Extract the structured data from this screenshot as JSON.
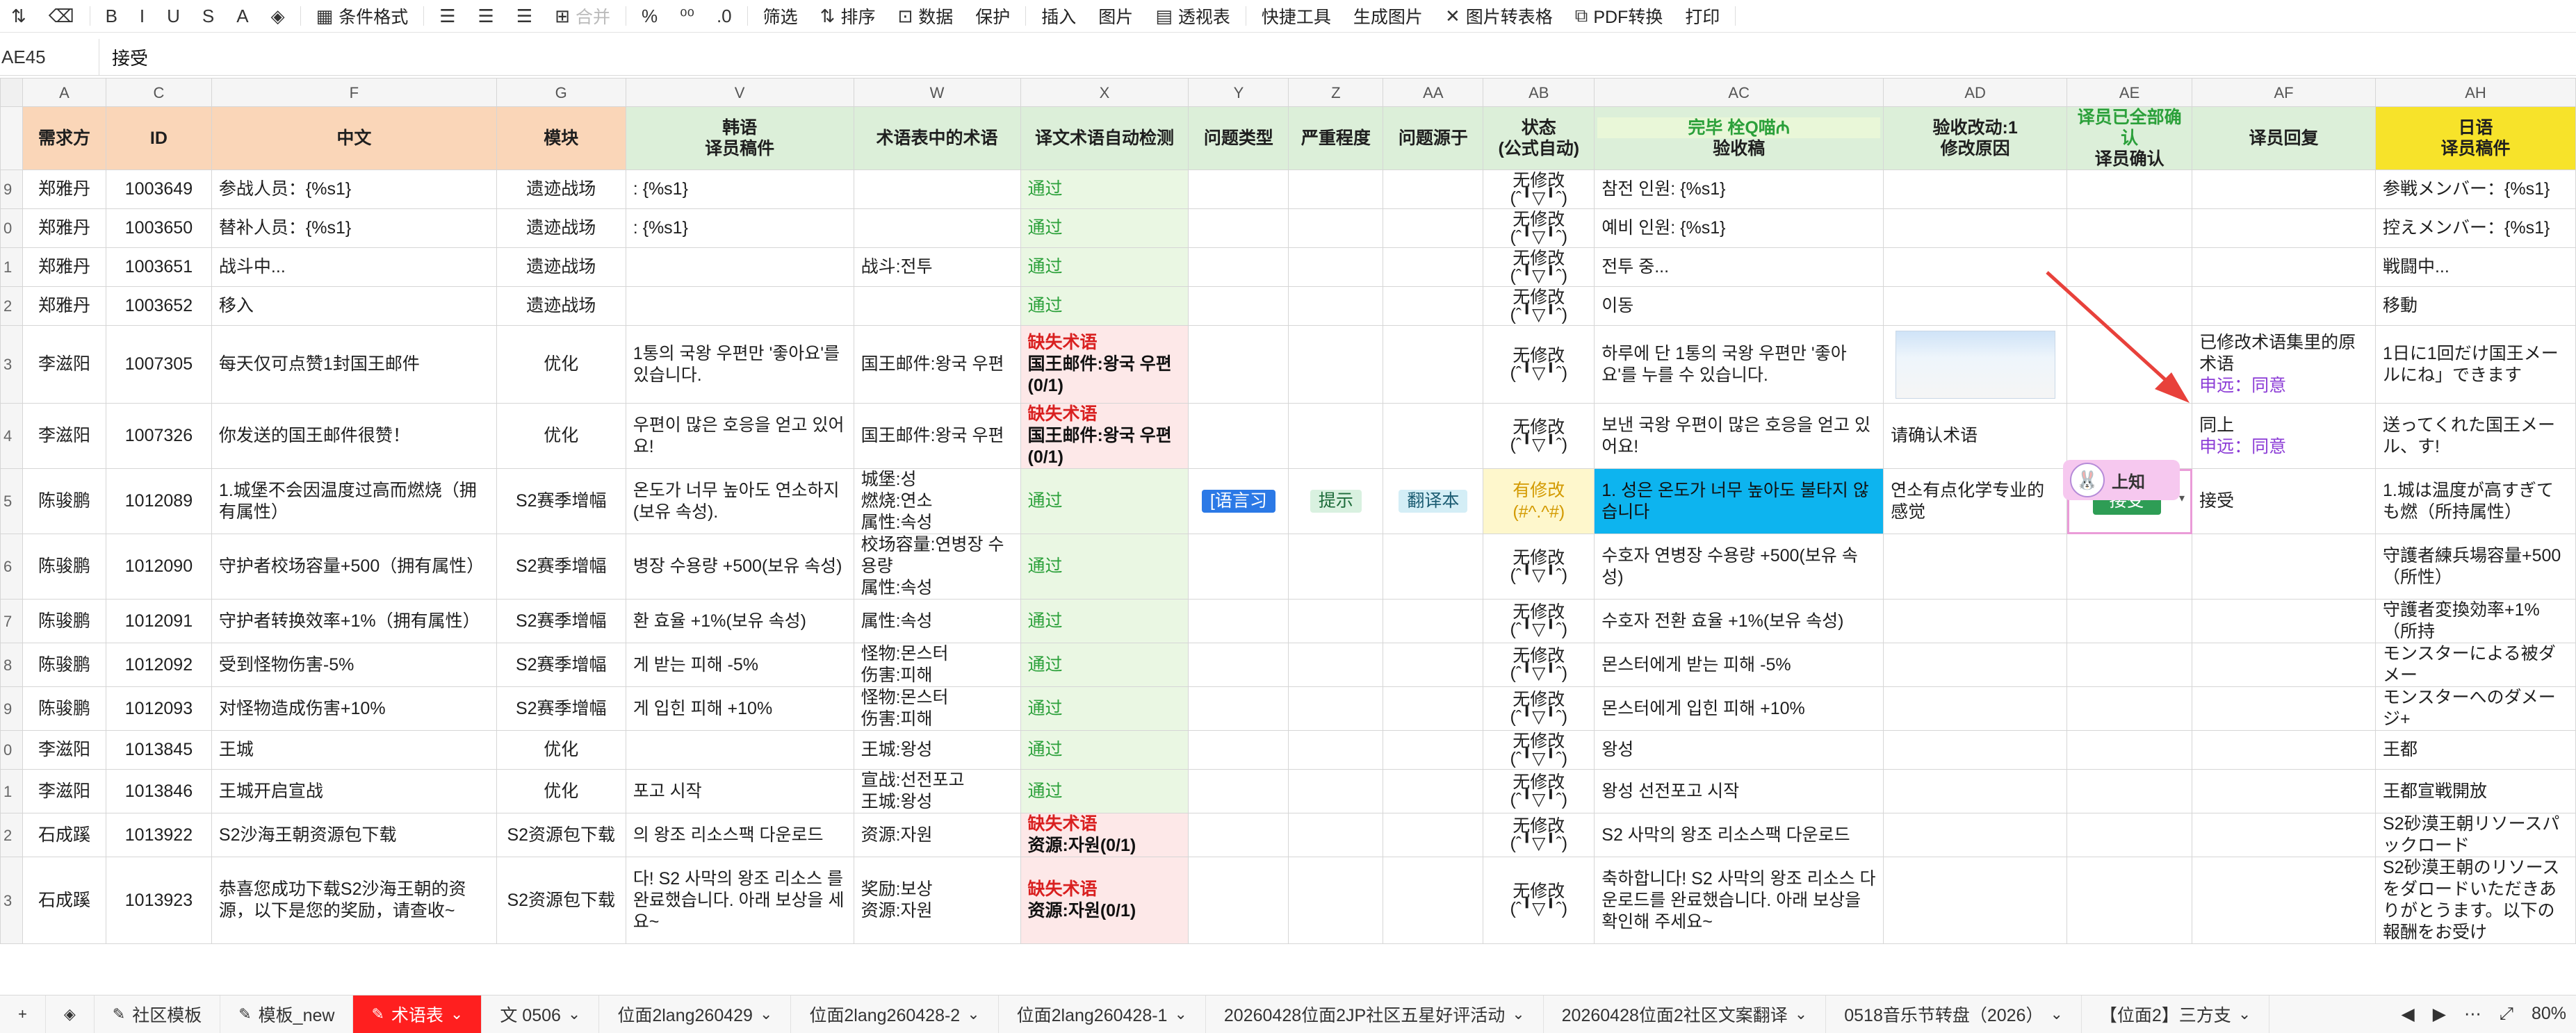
{
  "toolbar": {
    "items": [
      {
        "icon": "format-painter-icon",
        "glyph": "⇅",
        "label": ""
      },
      {
        "icon": "eraser-icon",
        "glyph": "⌫",
        "label": ""
      },
      {
        "icon": "bold-icon",
        "glyph": "B",
        "label": ""
      },
      {
        "icon": "italic-icon",
        "glyph": "I",
        "label": ""
      },
      {
        "icon": "underline-icon",
        "glyph": "U",
        "label": ""
      },
      {
        "icon": "strikethrough-icon",
        "glyph": "S",
        "label": ""
      },
      {
        "icon": "font-color-icon",
        "glyph": "A",
        "label": ""
      },
      {
        "icon": "fill-color-icon",
        "glyph": "◈",
        "label": ""
      },
      {
        "icon": "conditional-format-icon",
        "glyph": "▦",
        "label": "条件格式"
      },
      {
        "icon": "align-left-icon",
        "glyph": "☰",
        "label": ""
      },
      {
        "icon": "align-center-icon",
        "glyph": "☰",
        "label": ""
      },
      {
        "icon": "align-right-icon",
        "glyph": "☰",
        "label": ""
      },
      {
        "icon": "merge-icon",
        "glyph": "⊞",
        "label": "合并"
      },
      {
        "icon": "percent-icon",
        "glyph": "%",
        "label": ""
      },
      {
        "icon": "thousands-icon",
        "glyph": "⁰⁰",
        "label": ""
      },
      {
        "icon": "decimal-icon",
        "glyph": ".0",
        "label": ""
      },
      {
        "icon": "filter-icon",
        "glyph": "",
        "label": "筛选"
      },
      {
        "icon": "sort-icon",
        "glyph": "⇅",
        "label": "排序"
      },
      {
        "icon": "data-icon",
        "glyph": "⊡",
        "label": "数据"
      },
      {
        "icon": "protect-icon",
        "glyph": "",
        "label": "保护"
      },
      {
        "icon": "insert-icon",
        "glyph": "",
        "label": "插入"
      },
      {
        "icon": "image-icon",
        "glyph": "",
        "label": "图片"
      },
      {
        "icon": "pivot-icon",
        "glyph": "▤",
        "label": "透视表"
      },
      {
        "icon": "quick-tools-icon",
        "glyph": "",
        "label": "快捷工具"
      },
      {
        "icon": "gen-image-icon",
        "glyph": "",
        "label": "生成图片"
      },
      {
        "icon": "image-to-table-icon",
        "glyph": "✕",
        "label": "图片转表格"
      },
      {
        "icon": "pdf-convert-icon",
        "glyph": "⧉",
        "label": "PDF转换"
      },
      {
        "icon": "print-icon",
        "glyph": "",
        "label": "打印"
      }
    ]
  },
  "formula_bar": {
    "cell_ref": "AE45",
    "value": "接受"
  },
  "columns": [
    "A",
    "C",
    "F",
    "G",
    "V",
    "W",
    "X",
    "Y",
    "Z",
    "AA",
    "AB",
    "AC",
    "AD",
    "AE",
    "AF",
    "AH"
  ],
  "header": {
    "a": "需求方",
    "c": "ID",
    "f": "中文",
    "g": "模块",
    "v1": "韩语",
    "v2": "译员稿件",
    "w": "术语表中的术语",
    "x": "译文术语自动检测",
    "y": "问题类型",
    "z": "严重程度",
    "aa": "问题源于",
    "ab1": "状态",
    "ab2": "(公式自动)",
    "ac1": "完毕 栓Q喵₼",
    "ac2": "验收稿",
    "ad1": "验收改动:1",
    "ad2": "修改原因",
    "ae1": "译员已全部确认",
    "ae2": "译员确认",
    "af": "译员回复",
    "ah1": "日语",
    "ah2": "译员稿件"
  },
  "rows": [
    {
      "rn": "9",
      "a": "郑雅丹",
      "c": "1003649",
      "f": "参战人员：{%s1}",
      "g": "遗迹战场",
      "v": ": {%s1}",
      "w": "",
      "x": "通过",
      "ab": "无修改(ˆ╹▽╹ˆ)",
      "ac": "참전 인원: {%s1}",
      "ad": "",
      "ae": "",
      "af": "",
      "ah": "参戦メンバー：{%s1}"
    },
    {
      "rn": "0",
      "a": "郑雅丹",
      "c": "1003650",
      "f": "替补人员：{%s1}",
      "g": "遗迹战场",
      "v": ": {%s1}",
      "w": "",
      "x": "通过",
      "ab": "无修改(ˆ╹▽╹ˆ)",
      "ac": "예비 인원: {%s1}",
      "ad": "",
      "ae": "",
      "af": "",
      "ah": "控えメンバー：{%s1}"
    },
    {
      "rn": "1",
      "a": "郑雅丹",
      "c": "1003651",
      "f": "战斗中...",
      "g": "遗迹战场",
      "v": "",
      "w": "战斗:전투",
      "x": "通过",
      "ab": "无修改(ˆ╹▽╹ˆ)",
      "ac": "전투 중...",
      "ad": "",
      "ae": "",
      "af": "",
      "ah": "戦闘中..."
    },
    {
      "rn": "2",
      "a": "郑雅丹",
      "c": "1003652",
      "f": "移入",
      "g": "遗迹战场",
      "v": "",
      "w": "",
      "x": "通过",
      "ab": "无修改(ˆ╹▽╹ˆ)",
      "ac": "이동",
      "ad": "",
      "ae": "",
      "af": "",
      "ah": "移動"
    },
    {
      "rn": "3",
      "a": "李滋阳",
      "c": "1007305",
      "f": "每天仅可点赞1封国王邮件",
      "g": "优化",
      "v": "1통의 국왕 우편만 '좋아요'를 있습니다.",
      "w": "国王邮件:왕국 우편",
      "x_miss_title": "缺失术语",
      "x_miss_body": "国王邮件:왕국 우편(0/1)",
      "ab": "无修改(ˆ╹▽╹ˆ)",
      "ac": "하루에 단 1통의 국왕 우편만 '좋아요'를 누를 수 있습니다.",
      "ad": "",
      "ae": "",
      "af": "已修改术语集里的原术语",
      "af_reply": "申远：同意",
      "ah": "1日に1回だけ国王メールにね」できます"
    },
    {
      "rn": "4",
      "a": "李滋阳",
      "c": "1007326",
      "f": "你发送的国王邮件很赞！",
      "g": "优化",
      "v": "우편이 많은 호응을 얻고 있어요!",
      "w": "国王邮件:왕국 우편",
      "x_miss_title": "缺失术语",
      "x_miss_body": "国王邮件:왕국 우편(0/1)",
      "ab": "无修改(ˆ╹▽╹ˆ)",
      "ac": "보낸 국왕 우편이 많은 호응을 얻고 있어요!",
      "ad": "请确认术语",
      "ae": "",
      "af": "同上",
      "af_reply": "申远：同意",
      "ah": "送ってくれた国王メール、す!"
    },
    {
      "rn": "5",
      "a": "陈骏鹏",
      "c": "1012089",
      "f": "1.城堡不会因温度过高而燃烧（拥有属性）",
      "g": "S2赛季增幅",
      "v": "온도가 너무 높아도 연소하지 (보유 속성).",
      "w": "城堡:성\n燃烧:연소\n属性:속성",
      "x": "通过",
      "y": "[语言习",
      "z": "提示",
      "aa": "翻译本",
      "ab": "有修改(#^.^#)",
      "ac": "1. 성은 온도가 너무 높아도 불타지 않습니다",
      "ad": "연소有点化学专业的感觉",
      "ae": "接受",
      "af": "接受",
      "ah": "1.城は温度が高すぎても燃（所持属性）"
    },
    {
      "rn": "6",
      "a": "陈骏鹏",
      "c": "1012090",
      "f": "守护者校场容量+500（拥有属性）",
      "g": "S2赛季增幅",
      "v": "병장 수용량 +500(보유 속성)",
      "w": "校场容量:연병장 수용량\n属性:속성",
      "x": "通过",
      "ab": "无修改(ˆ╹▽╹ˆ)",
      "ac": "수호자 연병장 수용량 +500(보유 속성)",
      "ad": "",
      "ae": "",
      "af": "",
      "ah": "守護者練兵場容量+500（所性）"
    },
    {
      "rn": "7",
      "a": "陈骏鹏",
      "c": "1012091",
      "f": "守护者转换效率+1%（拥有属性）",
      "g": "S2赛季增幅",
      "v": "환 효율 +1%(보유 속성)",
      "w": "属性:속성",
      "x": "通过",
      "ab": "无修改(ˆ╹▽╹ˆ)",
      "ac": "수호자 전환 효율 +1%(보유 속성)",
      "ad": "",
      "ae": "",
      "af": "",
      "ah": "守護者変換効率+1%（所持"
    },
    {
      "rn": "8",
      "a": "陈骏鹏",
      "c": "1012092",
      "f": "受到怪物伤害-5%",
      "g": "S2赛季增幅",
      "v": "게 받는 피해 -5%",
      "w": "怪物:몬스터\n伤害:피해",
      "x": "通过",
      "ab": "无修改(ˆ╹▽╹ˆ)",
      "ac": "몬스터에게 받는 피해 -5%",
      "ad": "",
      "ae": "",
      "af": "",
      "ah": "モンスターによる被ダメー"
    },
    {
      "rn": "9",
      "a": "陈骏鹏",
      "c": "1012093",
      "f": "对怪物造成伤害+10%",
      "g": "S2赛季增幅",
      "v": "게 입힌 피해 +10%",
      "w": "怪物:몬스터\n伤害:피해",
      "x": "通过",
      "ab": "无修改(ˆ╹▽╹ˆ)",
      "ac": "몬스터에게 입힌 피해 +10%",
      "ad": "",
      "ae": "",
      "af": "",
      "ah": "モンスターへのダメージ+"
    },
    {
      "rn": "0",
      "a": "李滋阳",
      "c": "1013845",
      "f": "王城",
      "g": "优化",
      "v": "",
      "w": "王城:왕성",
      "x": "通过",
      "ab": "无修改(ˆ╹▽╹ˆ)",
      "ac": "왕성",
      "ad": "",
      "ae": "",
      "af": "",
      "ah": "王都"
    },
    {
      "rn": "1",
      "a": "李滋阳",
      "c": "1013846",
      "f": "王城开启宣战",
      "g": "优化",
      "v": "포고 시작",
      "w": "宣战:선전포고\n王城:왕성",
      "x": "通过",
      "ab": "无修改(ˆ╹▽╹ˆ)",
      "ac": "왕성 선전포고 시작",
      "ad": "",
      "ae": "",
      "af": "",
      "ah": "王都宣戦開放"
    },
    {
      "rn": "2",
      "a": "石成蹊",
      "c": "1013922",
      "f": "S2沙海王朝资源包下载",
      "g": "S2资源包下载",
      "v": "의 왕조 리소스팩 다운로드",
      "w": "资源:자원",
      "x_miss_title": "缺失术语",
      "x_miss_body": "资源:자원(0/1)",
      "ab": "无修改(ˆ╹▽╹ˆ)",
      "ac": "S2 사막의 왕조 리소스팩 다운로드",
      "ad": "",
      "ae": "",
      "af": "",
      "ah": "S2砂漠王朝リソースパックロード"
    },
    {
      "rn": "3",
      "a": "石成蹊",
      "c": "1013923",
      "f": "恭喜您成功下载S2沙海王朝的资源，以下是您的奖励，请查收~",
      "g": "S2资源包下载",
      "v": "다! S2 사막의 왕조 리소스 를 완료했습니다. 아래 보상을 세요~",
      "w": "奖励:보상\n资源:자원",
      "x_miss_title": "缺失术语",
      "x_miss_body": "资源:자원(0/1)",
      "ab": "无修改(ˆ╹▽╹ˆ)",
      "ac": "축하합니다! S2 사막의 왕조 리소스 다운로드를 완료했습니다. 아래 보상을 확인해 주세요~",
      "ad": "",
      "ae": "",
      "af": "",
      "ah": "S2砂漠王朝のリソースをダロードいただきありがとうます。以下の報酬をお受け"
    }
  ],
  "sticker": {
    "label": "上知"
  },
  "tabs": [
    {
      "label": "社区模板",
      "active": false
    },
    {
      "label": "模板_new",
      "active": false
    },
    {
      "label": "术语表",
      "active": true
    },
    {
      "label": "文 0506",
      "active": false
    },
    {
      "label": "位面2lang260429",
      "active": false
    },
    {
      "label": "位面2lang260428-2",
      "active": false
    },
    {
      "label": "位面2lang260428-1",
      "active": false
    },
    {
      "label": "20260428位面2JP社区五星好评活动",
      "active": false
    },
    {
      "label": "20260428位面2社区文案翻译",
      "active": false
    },
    {
      "label": "0518音乐节转盘（2026）",
      "active": false
    },
    {
      "label": "【位面2】三方支",
      "active": false
    }
  ],
  "zoom": "80%",
  "colors": {
    "orange_header": "#fad6b8",
    "green_header": "#dcefd9",
    "pass": "#2ba03a",
    "miss_bg": "#fde8e8",
    "selected_cell": "#0db4ef",
    "active_tab": "#ff1f1f",
    "arrow": "#e8413b"
  }
}
